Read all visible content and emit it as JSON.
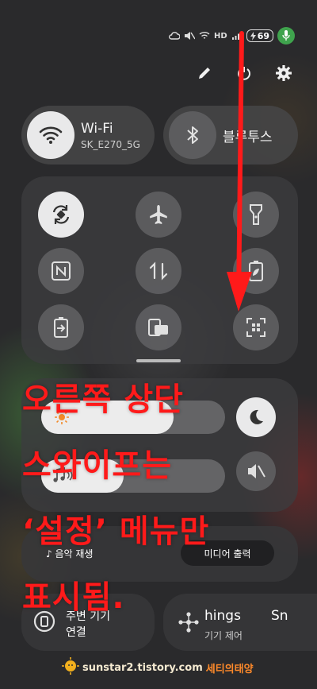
{
  "status": {
    "signal_label": "HD",
    "battery": "69"
  },
  "header": {
    "pencil_icon": "pencil-icon",
    "power_icon": "power-icon",
    "settings_icon": "gear-icon"
  },
  "tiles": {
    "wifi": {
      "label": "Wi-Fi",
      "network": "SK_E270_5G"
    },
    "bluetooth": {
      "label": "블루투스"
    }
  },
  "quick_settings": [
    {
      "name": "auto-rotate",
      "active": true
    },
    {
      "name": "airplane-mode",
      "active": false
    },
    {
      "name": "flashlight",
      "active": false
    },
    {
      "name": "nfc",
      "active": false
    },
    {
      "name": "mobile-data",
      "active": false
    },
    {
      "name": "power-saving",
      "active": false
    },
    {
      "name": "battery-share",
      "active": false
    },
    {
      "name": "smart-view",
      "active": false
    },
    {
      "name": "qr-scan",
      "active": false
    }
  ],
  "brightness": {
    "level": 0.72
  },
  "volume": {
    "level": 0.45
  },
  "media": {
    "play_label": "음악 재생",
    "output_label": "미디어 출력"
  },
  "bottom": {
    "device_label_1": "주변 기기",
    "device_label_2": "연결",
    "things_label": "hings",
    "things_sub": "기기 제어",
    "extra_label": "Sn"
  },
  "annotation": {
    "line1": "오른쪽 상단",
    "line2": "스와이프는",
    "line3": "‘설정’ 메뉴만",
    "line4": "표시됨."
  },
  "watermark": {
    "url": "sunstar2.tistory.com",
    "brand": "세티의태양"
  },
  "colors": {
    "annotation": "#ff1a1a",
    "mic": "#3fa34d"
  }
}
